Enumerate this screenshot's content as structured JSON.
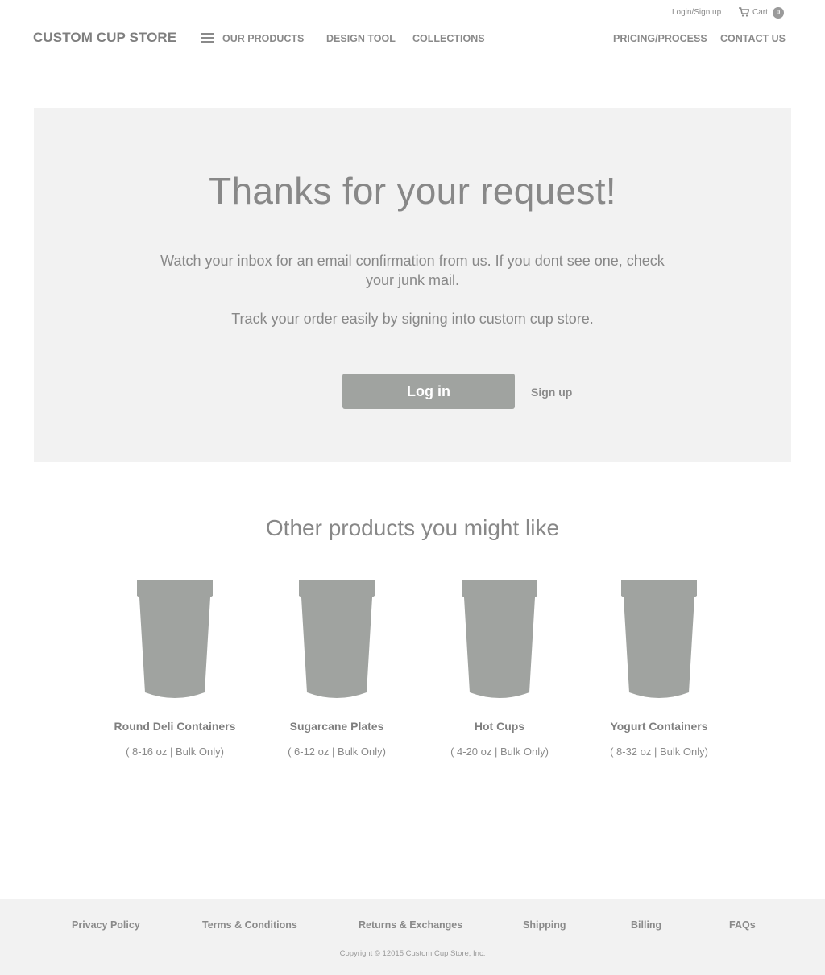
{
  "header": {
    "logo": "CUSTOM CUP STORE",
    "nav": {
      "our_products": "OUR PRODUCTS",
      "design_tool": "DESIGN TOOL",
      "collections": "COLLECTIONS",
      "pricing": "PRICING/PROCESS",
      "contact": "CONTACT US"
    },
    "utility": {
      "login": "Login/Sign up",
      "cart": "Cart",
      "cart_count": "0"
    }
  },
  "hero": {
    "title": "Thanks for your request!",
    "message": "Watch your inbox for an email confirmation from us. If you dont see one, check your junk mail.",
    "message2": "Track your order easily by signing into custom cup store.",
    "login_button": "Log in",
    "signup_link": "Sign up"
  },
  "products": {
    "title": "Other products you might like",
    "items": [
      {
        "name": "Round Deli Containers",
        "spec": "( 8-16 oz | Bulk Only)"
      },
      {
        "name": "Sugarcane Plates",
        "spec": "( 6-12 oz | Bulk Only)"
      },
      {
        "name": "Hot Cups",
        "spec": "( 4-20 oz | Bulk Only)"
      },
      {
        "name": "Yogurt Containers",
        "spec": "( 8-32 oz | Bulk Only)"
      }
    ]
  },
  "footer": {
    "links": [
      "Privacy Policy",
      "Terms & Conditions",
      "Returns & Exchanges",
      "Shipping",
      "Billing",
      "FAQs"
    ],
    "copyright": "Copyright © 12015 Custom Cup Store, Inc."
  },
  "colors": {
    "text": "#888888",
    "panel": "#f2f2f2",
    "button": "#a0a3a0",
    "cup": "#a0a3a0"
  }
}
